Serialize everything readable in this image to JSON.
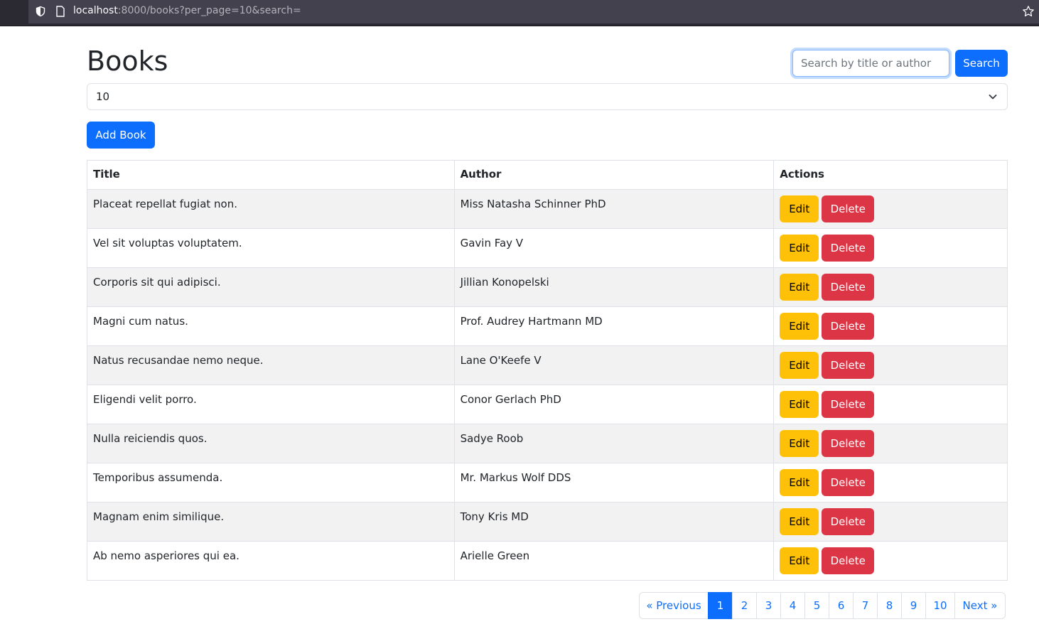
{
  "browser": {
    "url_host": "localhost",
    "url_rest": ":8000/books?per_page=10&search="
  },
  "page": {
    "title": "Books"
  },
  "search": {
    "placeholder": "Search by title or author",
    "value": "",
    "button_label": "Search"
  },
  "per_page": {
    "selected": "10"
  },
  "add_button_label": "Add Book",
  "table": {
    "headers": [
      "Title",
      "Author",
      "Actions"
    ],
    "edit_label": "Edit",
    "delete_label": "Delete",
    "rows": [
      {
        "title": "Placeat repellat fugiat non.",
        "author": "Miss Natasha Schinner PhD"
      },
      {
        "title": "Vel sit voluptas voluptatem.",
        "author": "Gavin Fay V"
      },
      {
        "title": "Corporis sit qui adipisci.",
        "author": "Jillian Konopelski"
      },
      {
        "title": "Magni cum natus.",
        "author": "Prof. Audrey Hartmann MD"
      },
      {
        "title": "Natus recusandae nemo neque.",
        "author": "Lane O'Keefe V"
      },
      {
        "title": "Eligendi velit porro.",
        "author": "Conor Gerlach PhD"
      },
      {
        "title": "Nulla reiciendis quos.",
        "author": "Sadye Roob"
      },
      {
        "title": "Temporibus assumenda.",
        "author": "Mr. Markus Wolf DDS"
      },
      {
        "title": "Magnam enim similique.",
        "author": "Tony Kris MD"
      },
      {
        "title": "Ab nemo asperiores qui ea.",
        "author": "Arielle Green"
      }
    ]
  },
  "pagination": {
    "previous": "« Previous",
    "next": "Next »",
    "pages": [
      "1",
      "2",
      "3",
      "4",
      "5",
      "6",
      "7",
      "8",
      "9",
      "10"
    ],
    "active": "1"
  },
  "colors": {
    "primary": "#0d6efd",
    "warning": "#ffc107",
    "danger": "#dc3545"
  }
}
